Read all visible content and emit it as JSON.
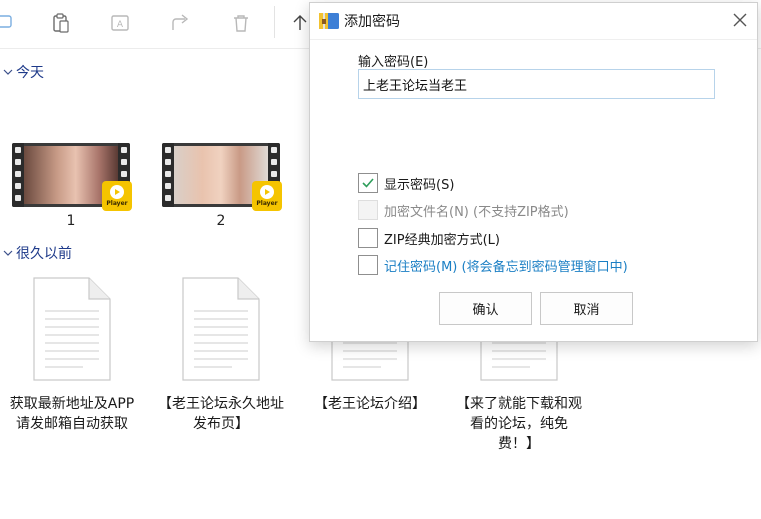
{
  "toolbar": {
    "icons": [
      "chat-icon",
      "paste-icon",
      "rename-icon",
      "share-icon",
      "delete-icon",
      "sort-icon"
    ]
  },
  "groups": {
    "today_label": "今天",
    "long_ago_label": "很久以前"
  },
  "videos": [
    {
      "label": "1"
    },
    {
      "label": "2"
    }
  ],
  "player_badge_text": "Player",
  "documents": [
    {
      "label": "获取最新地址及APP请发邮箱自动获取"
    },
    {
      "label": "【老王论坛永久地址发布页】"
    },
    {
      "label": "【老王论坛介绍】"
    },
    {
      "label": "【来了就能下载和观看的论坛，纯免费！】"
    }
  ],
  "dialog": {
    "title": "添加密码",
    "password_label": "输入密码(E)",
    "password_value": "上老王论坛当老王",
    "show_password": {
      "label": "显示密码(S)",
      "checked": true
    },
    "encrypt_filenames": {
      "label": "加密文件名(N) (不支持ZIP格式)",
      "checked": false,
      "disabled": true
    },
    "zip_legacy": {
      "label": "ZIP经典加密方式(L)",
      "checked": false
    },
    "remember_password": {
      "label": "记住密码(M) (将会备忘到密码管理窗口中)",
      "checked": false
    },
    "ok_label": "确认",
    "cancel_label": "取消"
  },
  "colors": {
    "link": "#1b7fc4",
    "check": "#2e9e5b",
    "player_badge": "#f5c400",
    "group_header": "#1e3a8a"
  }
}
